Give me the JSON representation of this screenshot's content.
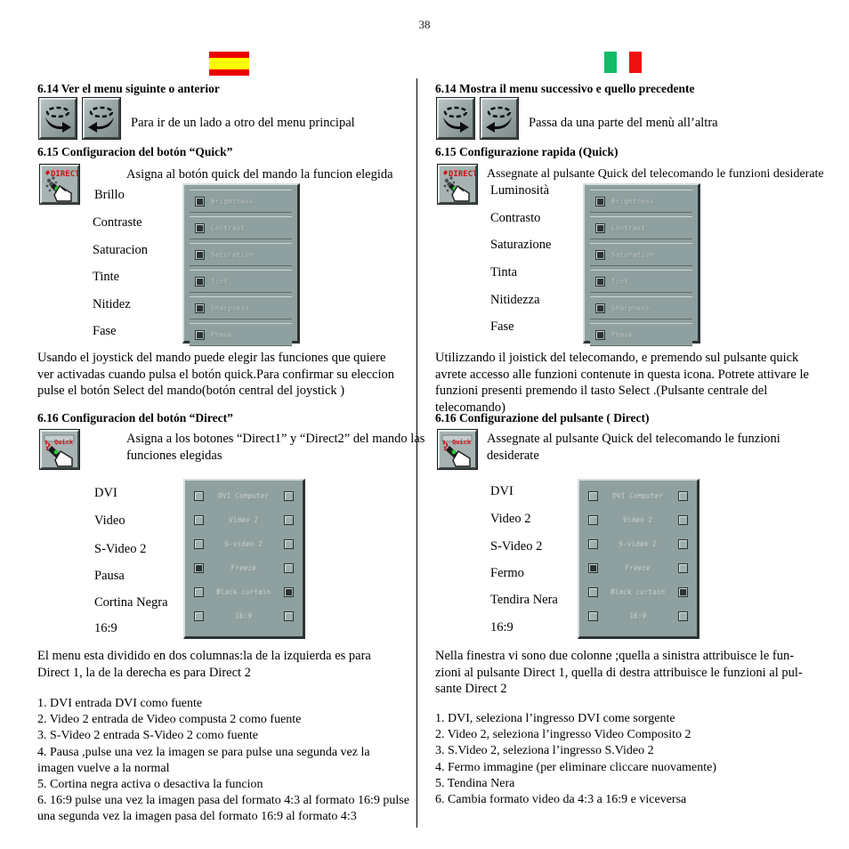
{
  "page": {
    "number": "38"
  },
  "flags": {
    "spanish": {
      "name": "spain-flag",
      "colors": [
        "#ee0000",
        "#ffff00",
        "#ee0000"
      ]
    },
    "italian": {
      "name": "italy-flag",
      "colors": [
        "#11bb66",
        "#ffffff",
        "#ee1111"
      ]
    }
  },
  "left": {
    "s614": {
      "heading": "6.14 Ver el menu siguinte o anterior",
      "caption": "Para ir  de un lado a otro del menu principal"
    },
    "s615": {
      "heading": "6.15 Configuracion del botón “Quick”",
      "caption": "Asigna al botón quick del mando la funcion elegida",
      "icon_label": "DIRECT",
      "items": [
        "Brillo",
        "Contraste",
        "Saturacion",
        "Tinte",
        "Nitidez",
        "Fase"
      ],
      "body": "Usando el joystick del mando  puede elegir las funciones que quiere ver activadas cuando pulsa el botón quick.Para confirmar su eleccion pulse el botón Select  del mando(botón central del joystick )"
    },
    "s616": {
      "heading": "6.16 Configuracion del botón “Direct”",
      "icon_label": "Quick",
      "caption": "Asigna a los botones “Direct1” y “Direct2” del mando las funciones elegidas",
      "items": [
        "DVI",
        "Video",
        "S-Video 2",
        "Pausa",
        "Cortina Negra",
        "16:9"
      ],
      "body": "El menu esta dividido en dos columnas:la de la izquierda es para Direct 1, la de la derecha es para Direct 2",
      "numbered": [
        "1. DVI entrada DVI como fuente",
        "2. Video 2 entrada de Video compusta 2 como fuente",
        "3. S-Video 2 entrada S-Video 2 como fuente",
        "4. Pausa ,pulse una vez la imagen se para pulse una segunda vez la imagen vuelve a la normal",
        "5. Cortina negra activa o desactiva la funcion",
        "6. 16:9 pulse una vez la imagen pasa del formato 4:3 al formato 16:9 pulse una segunda vez la imagen pasa del formato 16:9 al formato 4:3"
      ]
    }
  },
  "right": {
    "s614": {
      "heading": "6.14 Mostra il menu successivo e quello precedente",
      "caption": "Passa da una parte del menù all’altra"
    },
    "s615": {
      "heading": "6.15 Configurazione rapida (Quick)",
      "caption": "Assegnate al pulsante Quick del telecomando le funzioni desiderate",
      "icon_label": "DIRECT",
      "items": [
        "Luminosità",
        "Contrasto",
        "Saturazione",
        "Tinta",
        "Nitidezza",
        "Fase"
      ],
      "body": "Utilizzando il joistick  del telecomando, e premendo sul pulsante quick avrete accesso alle funzioni contenute in questa icona. Potrete attivare le funzioni presenti premendo il tasto Select .(Pulsante centrale del telecomando)"
    },
    "s616": {
      "heading": "6.16 Configurazione del pulsante ( Direct)",
      "icon_label": "Quick",
      "caption": "Assegnate al pulsante Quick del telecomando le funzioni desiderate",
      "items": [
        "DVI",
        "Video 2",
        "S-Video 2",
        "Fermo",
        "Tendira Nera",
        "16:9"
      ],
      "body": "Nella finestra vi sono due colonne ;quella a sinistra attribuisce le fun-zioni al pulsante Direct 1, quella di destra attribuisce le funzioni al pul-sante Direct 2",
      "numbered": [
        "1. DVI, seleziona l’ingresso DVI come sorgente",
        "2. Video 2, seleziona l’ingresso Video Composito 2",
        "3. S.Video 2, seleziona l’ingresso S.Video 2",
        "4. Fermo immagine (per eliminare cliccare nuovamente)",
        "5. Tendina Nera",
        "6. Cambia formato video da 4:3 a 16:9 e viceversa"
      ]
    }
  },
  "osd_quick": {
    "rows": [
      {
        "label": "Brightness",
        "checked": true
      },
      {
        "label": "Contrast",
        "checked": true
      },
      {
        "label": "Saturation",
        "checked": true
      },
      {
        "label": "Tint",
        "checked": true
      },
      {
        "label": "Sharpness",
        "checked": true
      },
      {
        "label": "Phase",
        "checked": true
      }
    ]
  },
  "osd_direct": {
    "rows": [
      {
        "label": "DVI Computer",
        "left_checked": false,
        "right_checked": false
      },
      {
        "label": "Video 2",
        "left_checked": false,
        "right_checked": false
      },
      {
        "label": "S-video 2",
        "left_checked": false,
        "right_checked": false
      },
      {
        "label": "Freeze",
        "left_checked": true,
        "right_checked": false
      },
      {
        "label": "Black curtain",
        "left_checked": false,
        "right_checked": true
      },
      {
        "label": "16:9",
        "left_checked": false,
        "right_checked": false
      }
    ]
  }
}
